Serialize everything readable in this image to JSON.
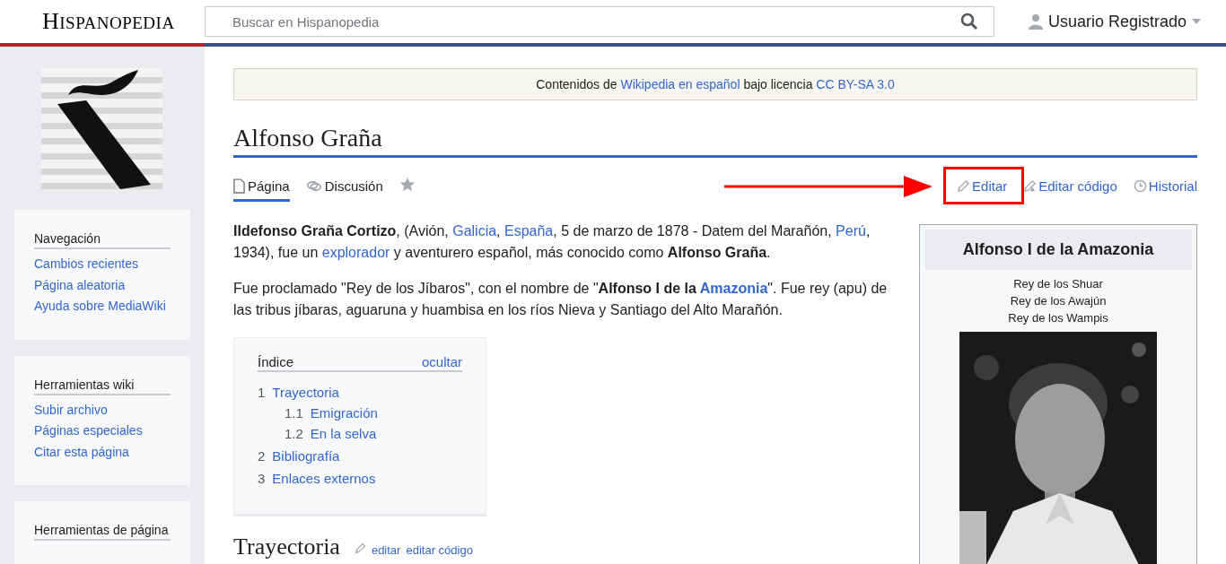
{
  "header": {
    "wordmark": "HISPANOPEDIA",
    "search": {
      "placeholder": "Buscar en Hispanopedia"
    },
    "user": "Usuario Registrado"
  },
  "sidebar": {
    "logo": {
      "kind": "picture"
    },
    "panels": [
      {
        "title": "Navegación",
        "items": [
          "Cambios recientes",
          "Página aleatoria",
          "Ayuda sobre MediaWiki"
        ]
      },
      {
        "title": "Herramientas wiki",
        "items": [
          "Subir archivo",
          "Páginas especiales",
          "Citar esta página"
        ]
      },
      {
        "title": "Herramientas de página"
      }
    ]
  },
  "notice": [
    {
      "kind": "text",
      "text": "Contenidos de "
    },
    {
      "kind": "link",
      "text": "Wikipedia en español"
    },
    {
      "kind": "text",
      "text": " bajo licencia "
    },
    {
      "kind": "link",
      "text": "CC BY-SA 3.0"
    }
  ],
  "title": "Alfonso Graña",
  "tabs": [
    {
      "label": "Página",
      "kind": "page",
      "selected": true
    },
    {
      "label": "Discusión",
      "kind": "talk",
      "selected": false
    }
  ],
  "watch": {
    "starred": false
  },
  "actions": [
    {
      "label": "Editar",
      "kind": "edit",
      "highlighted": true
    },
    {
      "label": "Editar código",
      "kind": "source",
      "highlighted": false
    },
    {
      "label": "Historial",
      "kind": "history",
      "highlighted": false
    }
  ],
  "paragraphs": [
    [
      {
        "kind": "bold",
        "text": "Ildefonso Graña Cortizo"
      },
      {
        "kind": "text",
        "text": ", (Avión, "
      },
      {
        "kind": "link",
        "text": "Galicia"
      },
      {
        "kind": "text",
        "text": ", "
      },
      {
        "kind": "link",
        "text": "España"
      },
      {
        "kind": "text",
        "text": ", 5 de marzo de 1878 - Datem del Marañón, "
      },
      {
        "kind": "link",
        "text": "Perú"
      },
      {
        "kind": "text",
        "text": ", 1934), fue un "
      },
      {
        "kind": "link",
        "text": "explorador"
      },
      {
        "kind": "text",
        "text": " y aventurero español, más conocido como "
      },
      {
        "kind": "bold",
        "text": "Alfonso Graña"
      },
      {
        "kind": "text",
        "text": "."
      }
    ],
    [
      {
        "kind": "text",
        "text": "Fue proclamado \"Rey de los Jíbaros\", con el nombre de \""
      },
      {
        "kind": "bold",
        "text": "Alfonso I de la "
      },
      {
        "kind": "boldlink",
        "text": "Amazonia"
      },
      {
        "kind": "text",
        "text": "\". Fue rey (apu) de las tribus jíbaras, aguaruna y huambisa en los ríos Nieva y Santiago del Alto Marañón."
      }
    ]
  ],
  "infobox": {
    "title": "Alfonso I de la Amazonia",
    "lines": [
      "Rey de los Shuar",
      "Rey de los Awajún",
      "Rey de los Wampis"
    ],
    "photo": {
      "kind": "picture"
    }
  },
  "toc": {
    "title": "Índice",
    "toggle": "ocultar",
    "items": [
      {
        "number": "1",
        "label": "Trayectoria",
        "children": [
          {
            "number": "1.1",
            "label": "Emigración"
          },
          {
            "number": "1.2",
            "label": "En la selva"
          }
        ]
      },
      {
        "number": "2",
        "label": "Bibliografía"
      },
      {
        "number": "3",
        "label": "Enlaces externos"
      }
    ]
  },
  "section": {
    "heading": "Trayectoria",
    "links": [
      "editar",
      "editar código"
    ]
  }
}
